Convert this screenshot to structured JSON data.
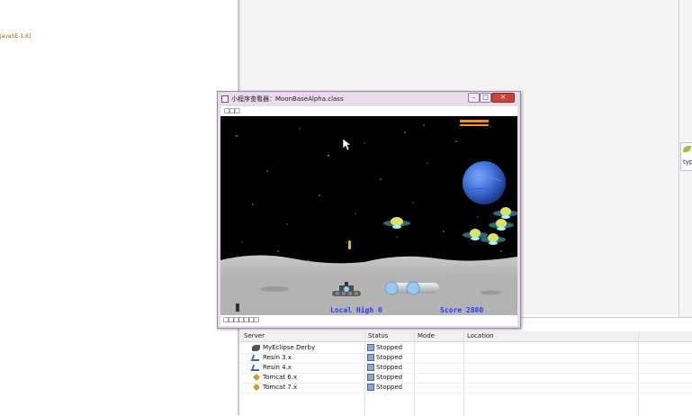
{
  "editor": {
    "jre_label": "JavaSE-1.6]"
  },
  "side_tab": {
    "label": "typ"
  },
  "servers": {
    "columns": [
      "Server",
      "Status",
      "Mode",
      "Location"
    ],
    "rows": [
      {
        "name": "MyEclipse Derby",
        "status": "Stopped",
        "icon": "derby-icon"
      },
      {
        "name": "Resin  3.x",
        "status": "Stopped",
        "icon": "resin-icon"
      },
      {
        "name": "Resin  4.x",
        "status": "Stopped",
        "icon": "resin-icon"
      },
      {
        "name": "Tomcat  6.x",
        "status": "Stopped",
        "icon": "tomcat-icon"
      },
      {
        "name": "Tomcat  7.x",
        "status": "Stopped",
        "icon": "tomcat-icon"
      }
    ]
  },
  "game_window": {
    "title": "小程序查看器：MoonBaseAlpha.class",
    "menu": "□□□",
    "status": "□□□□□□□",
    "buttons": {
      "minimize": "–",
      "maximize": "□",
      "close": "✕"
    },
    "hud": {
      "local_high": "Local High 0",
      "score": "Score 2800"
    },
    "colors": {
      "hud_text": "#2a3cff",
      "planet": "#3f6fd6",
      "energy_bar": "#ff8a1a"
    }
  }
}
